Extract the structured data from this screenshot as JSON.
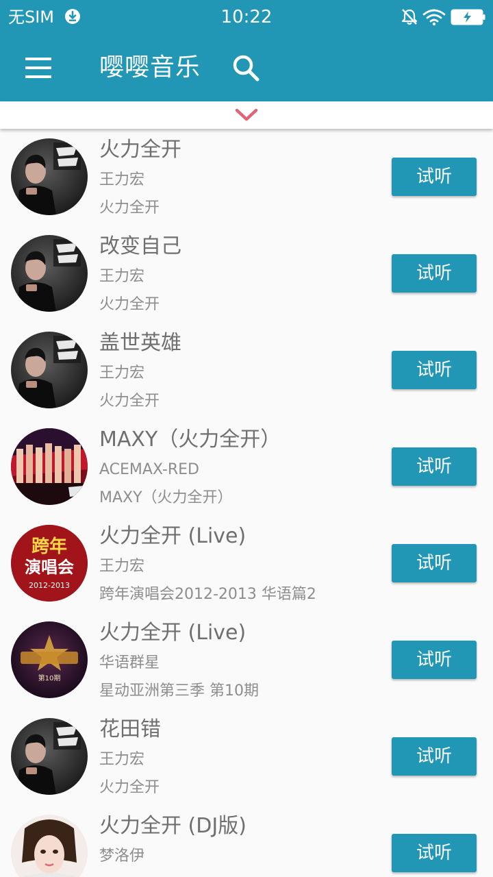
{
  "status_bar": {
    "carrier": "无SIM",
    "time": "10:22"
  },
  "app_bar": {
    "title": "嘤嘤音乐"
  },
  "theme": {
    "primary": "#2196b5",
    "chevron": "#e06377"
  },
  "songs": [
    {
      "title": "火力全开",
      "artist": "王力宏",
      "album": "火力全开",
      "button": "试听",
      "cover": "wang-leehom"
    },
    {
      "title": "改变自己",
      "artist": "王力宏",
      "album": "火力全开",
      "button": "试听",
      "cover": "wang-leehom"
    },
    {
      "title": "盖世英雄",
      "artist": "王力宏",
      "album": "火力全开",
      "button": "试听",
      "cover": "wang-leehom"
    },
    {
      "title": "MAXY（火力全开）",
      "artist": "ACEMAX-RED",
      "album": "MAXY（火力全开）",
      "button": "试听",
      "cover": "maxy"
    },
    {
      "title": "火力全开 (Live)",
      "artist": "王力宏",
      "album": "跨年演唱会2012-2013 华语篇2",
      "button": "试听",
      "cover": "kuanian",
      "cover_text": [
        "跨年",
        "演唱会",
        "2012-2013"
      ]
    },
    {
      "title": "火力全开 (Live)",
      "artist": "华语群星",
      "album": "星动亚洲第三季 第10期",
      "button": "试听",
      "cover": "xingdong",
      "cover_text": [
        "第10期"
      ]
    },
    {
      "title": "花田错",
      "artist": "王力宏",
      "album": "火力全开",
      "button": "试听",
      "cover": "wang-leehom"
    },
    {
      "title": "火力全开 (DJ版)",
      "artist": "梦洛伊",
      "album": "",
      "button": "试听",
      "cover": "mengluoyi"
    }
  ]
}
